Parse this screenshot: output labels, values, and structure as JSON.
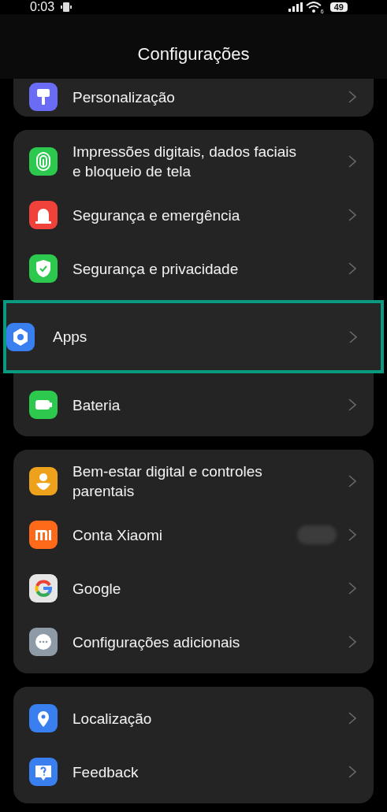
{
  "status_bar": {
    "time": "0:03",
    "wifi_label": "6",
    "battery": "49"
  },
  "header": {
    "title": "Configurações"
  },
  "groups": [
    {
      "items": [
        {
          "label": "Personalização",
          "highlighted": false,
          "redacted": false
        }
      ]
    },
    {
      "items": [
        {
          "label": "Impressões digitais, dados faciais e bloqueio de tela",
          "highlighted": false,
          "redacted": false
        },
        {
          "label": "Segurança e emergência",
          "highlighted": false,
          "redacted": false
        },
        {
          "label": "Segurança e privacidade",
          "highlighted": false,
          "redacted": false
        },
        {
          "label": "Apps",
          "highlighted": true,
          "redacted": false
        },
        {
          "label": "Bateria",
          "highlighted": false,
          "redacted": false
        }
      ]
    },
    {
      "items": [
        {
          "label": "Bem-estar digital e controles parentais",
          "highlighted": false,
          "redacted": false
        },
        {
          "label": "Conta Xiaomi",
          "highlighted": false,
          "redacted": true
        },
        {
          "label": "Google",
          "highlighted": false,
          "redacted": false
        },
        {
          "label": "Configurações adicionais",
          "highlighted": false,
          "redacted": false
        }
      ]
    },
    {
      "items": [
        {
          "label": "Localização",
          "highlighted": false,
          "redacted": false
        },
        {
          "label": "Feedback",
          "highlighted": false,
          "redacted": false
        }
      ]
    }
  ]
}
